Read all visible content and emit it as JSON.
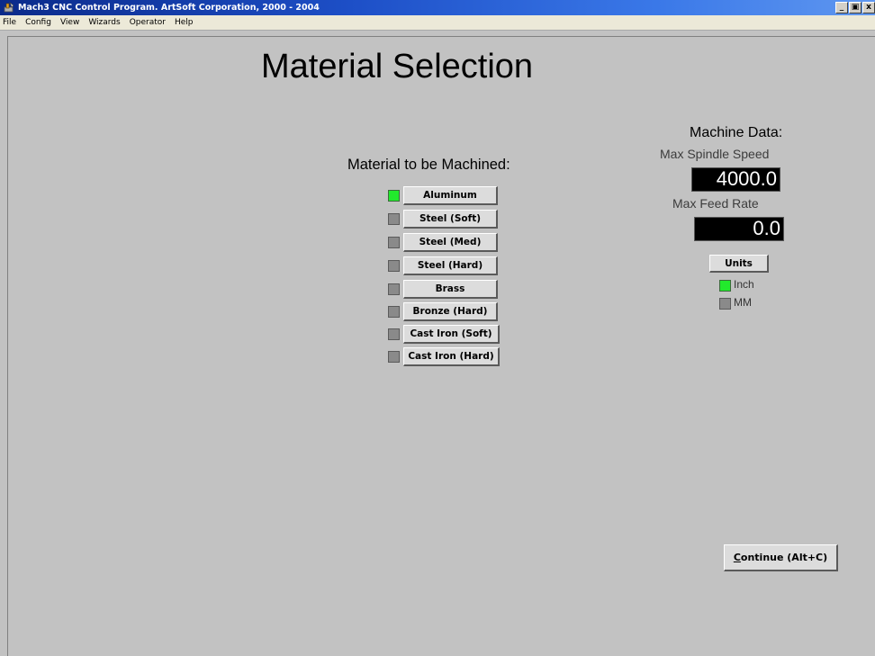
{
  "window": {
    "title": "Mach3 CNC Control Program. ArtSoft Corporation, 2000 - 2004",
    "controls": {
      "minimize": "_",
      "restore": "▣",
      "close": "x"
    }
  },
  "menubar": {
    "items": [
      "File",
      "Config",
      "View",
      "Wizards",
      "Operator",
      "Help"
    ]
  },
  "page": {
    "title": "Material Selection"
  },
  "materials": {
    "heading": "Material to be Machined:",
    "items": [
      {
        "label": "Aluminum",
        "selected": true
      },
      {
        "label": "Steel (Soft)",
        "selected": false
      },
      {
        "label": "Steel (Med)",
        "selected": false
      },
      {
        "label": "Steel (Hard)",
        "selected": false
      },
      {
        "label": "Brass",
        "selected": false
      },
      {
        "label": "Bronze (Hard)",
        "selected": false
      },
      {
        "label": "Cast Iron (Soft)",
        "selected": false
      },
      {
        "label": "Cast Iron (Hard)",
        "selected": false
      }
    ]
  },
  "machine": {
    "heading": "Machine Data:",
    "spindle_label": "Max Spindle Speed",
    "spindle_value": "4000.0",
    "feed_label": "Max Feed Rate",
    "feed_value": "0.0",
    "units_button": "Units",
    "units": [
      {
        "label": "Inch",
        "selected": true
      },
      {
        "label": "MM",
        "selected": false
      }
    ]
  },
  "footer": {
    "continue_label": "Continue (Alt+C)"
  },
  "colors": {
    "led_on": "#22ea2c",
    "led_off": "#8a8a8a",
    "background": "#c2c2c2",
    "dro_bg": "#000000",
    "dro_fg": "#ffffff"
  }
}
